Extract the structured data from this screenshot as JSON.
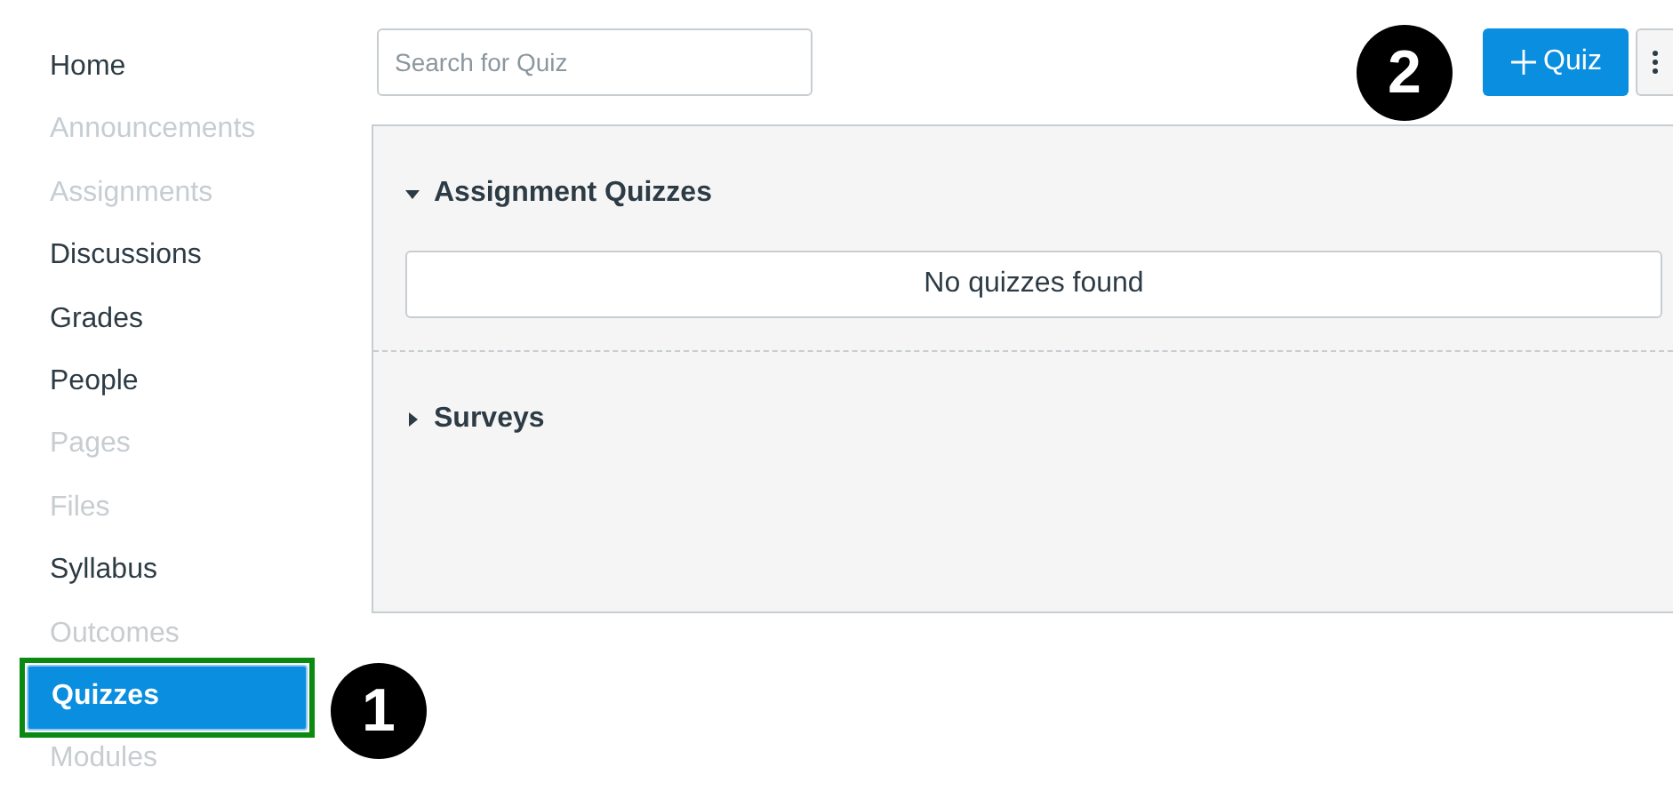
{
  "sidebar": {
    "items": [
      {
        "label": "Home",
        "disabled": false,
        "selected": false,
        "highlighted": false
      },
      {
        "label": "Announcements",
        "disabled": true,
        "selected": false,
        "highlighted": false
      },
      {
        "label": "Assignments",
        "disabled": true,
        "selected": false,
        "highlighted": false
      },
      {
        "label": "Discussions",
        "disabled": false,
        "selected": false,
        "highlighted": false
      },
      {
        "label": "Grades",
        "disabled": false,
        "selected": false,
        "highlighted": false
      },
      {
        "label": "People",
        "disabled": false,
        "selected": false,
        "highlighted": false
      },
      {
        "label": "Pages",
        "disabled": true,
        "selected": false,
        "highlighted": false
      },
      {
        "label": "Files",
        "disabled": true,
        "selected": false,
        "highlighted": false
      },
      {
        "label": "Syllabus",
        "disabled": false,
        "selected": false,
        "highlighted": false
      },
      {
        "label": "Outcomes",
        "disabled": true,
        "selected": false,
        "highlighted": false
      },
      {
        "label": "Quizzes",
        "disabled": false,
        "selected": true,
        "highlighted": true
      },
      {
        "label": "Modules",
        "disabled": true,
        "selected": false,
        "highlighted": false
      }
    ]
  },
  "search": {
    "placeholder": "Search for Quiz"
  },
  "toolbar": {
    "add_button": "Quiz"
  },
  "sections": [
    {
      "title": "Assignment Quizzes",
      "expanded": true,
      "empty_message": "No quizzes found"
    },
    {
      "title": "Surveys",
      "expanded": false
    }
  ],
  "callouts": [
    {
      "number": "1"
    },
    {
      "number": "2"
    }
  ]
}
